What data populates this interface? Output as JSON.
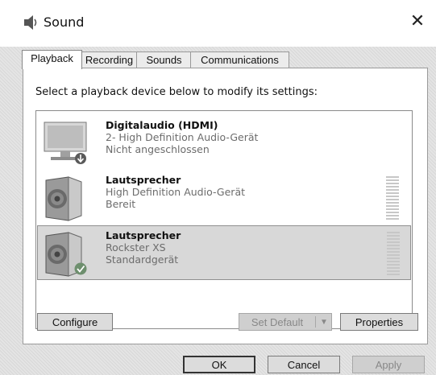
{
  "window": {
    "title": "Sound"
  },
  "tabs": [
    {
      "label": "Playback",
      "active": true
    },
    {
      "label": "Recording",
      "active": false
    },
    {
      "label": "Sounds",
      "active": false
    },
    {
      "label": "Communications",
      "active": false
    }
  ],
  "instruction": "Select a playback device below to modify its settings:",
  "devices": [
    {
      "name": "Digitalaudio (HDMI)",
      "description": "2- High Definition Audio-Gerät",
      "status": "Nicht angeschlossen",
      "icon": "monitor-icon",
      "badge": "down-arrow-badge",
      "selected": false,
      "has_meter": false
    },
    {
      "name": "Lautsprecher",
      "description": "High Definition Audio-Gerät",
      "status": "Bereit",
      "icon": "speaker-icon",
      "badge": "",
      "selected": false,
      "has_meter": true
    },
    {
      "name": "Lautsprecher",
      "description": "Rockster XS",
      "status": "Standardgerät",
      "icon": "speaker-icon",
      "badge": "checkmark-badge",
      "selected": true,
      "has_meter": true
    }
  ],
  "buttons": {
    "configure": "Configure",
    "set_default": "Set Default",
    "properties": "Properties",
    "ok": "OK",
    "cancel": "Cancel",
    "apply": "Apply"
  },
  "colors": {
    "selection": "#d8d8d8",
    "badge_green": "#6e8f6e"
  }
}
